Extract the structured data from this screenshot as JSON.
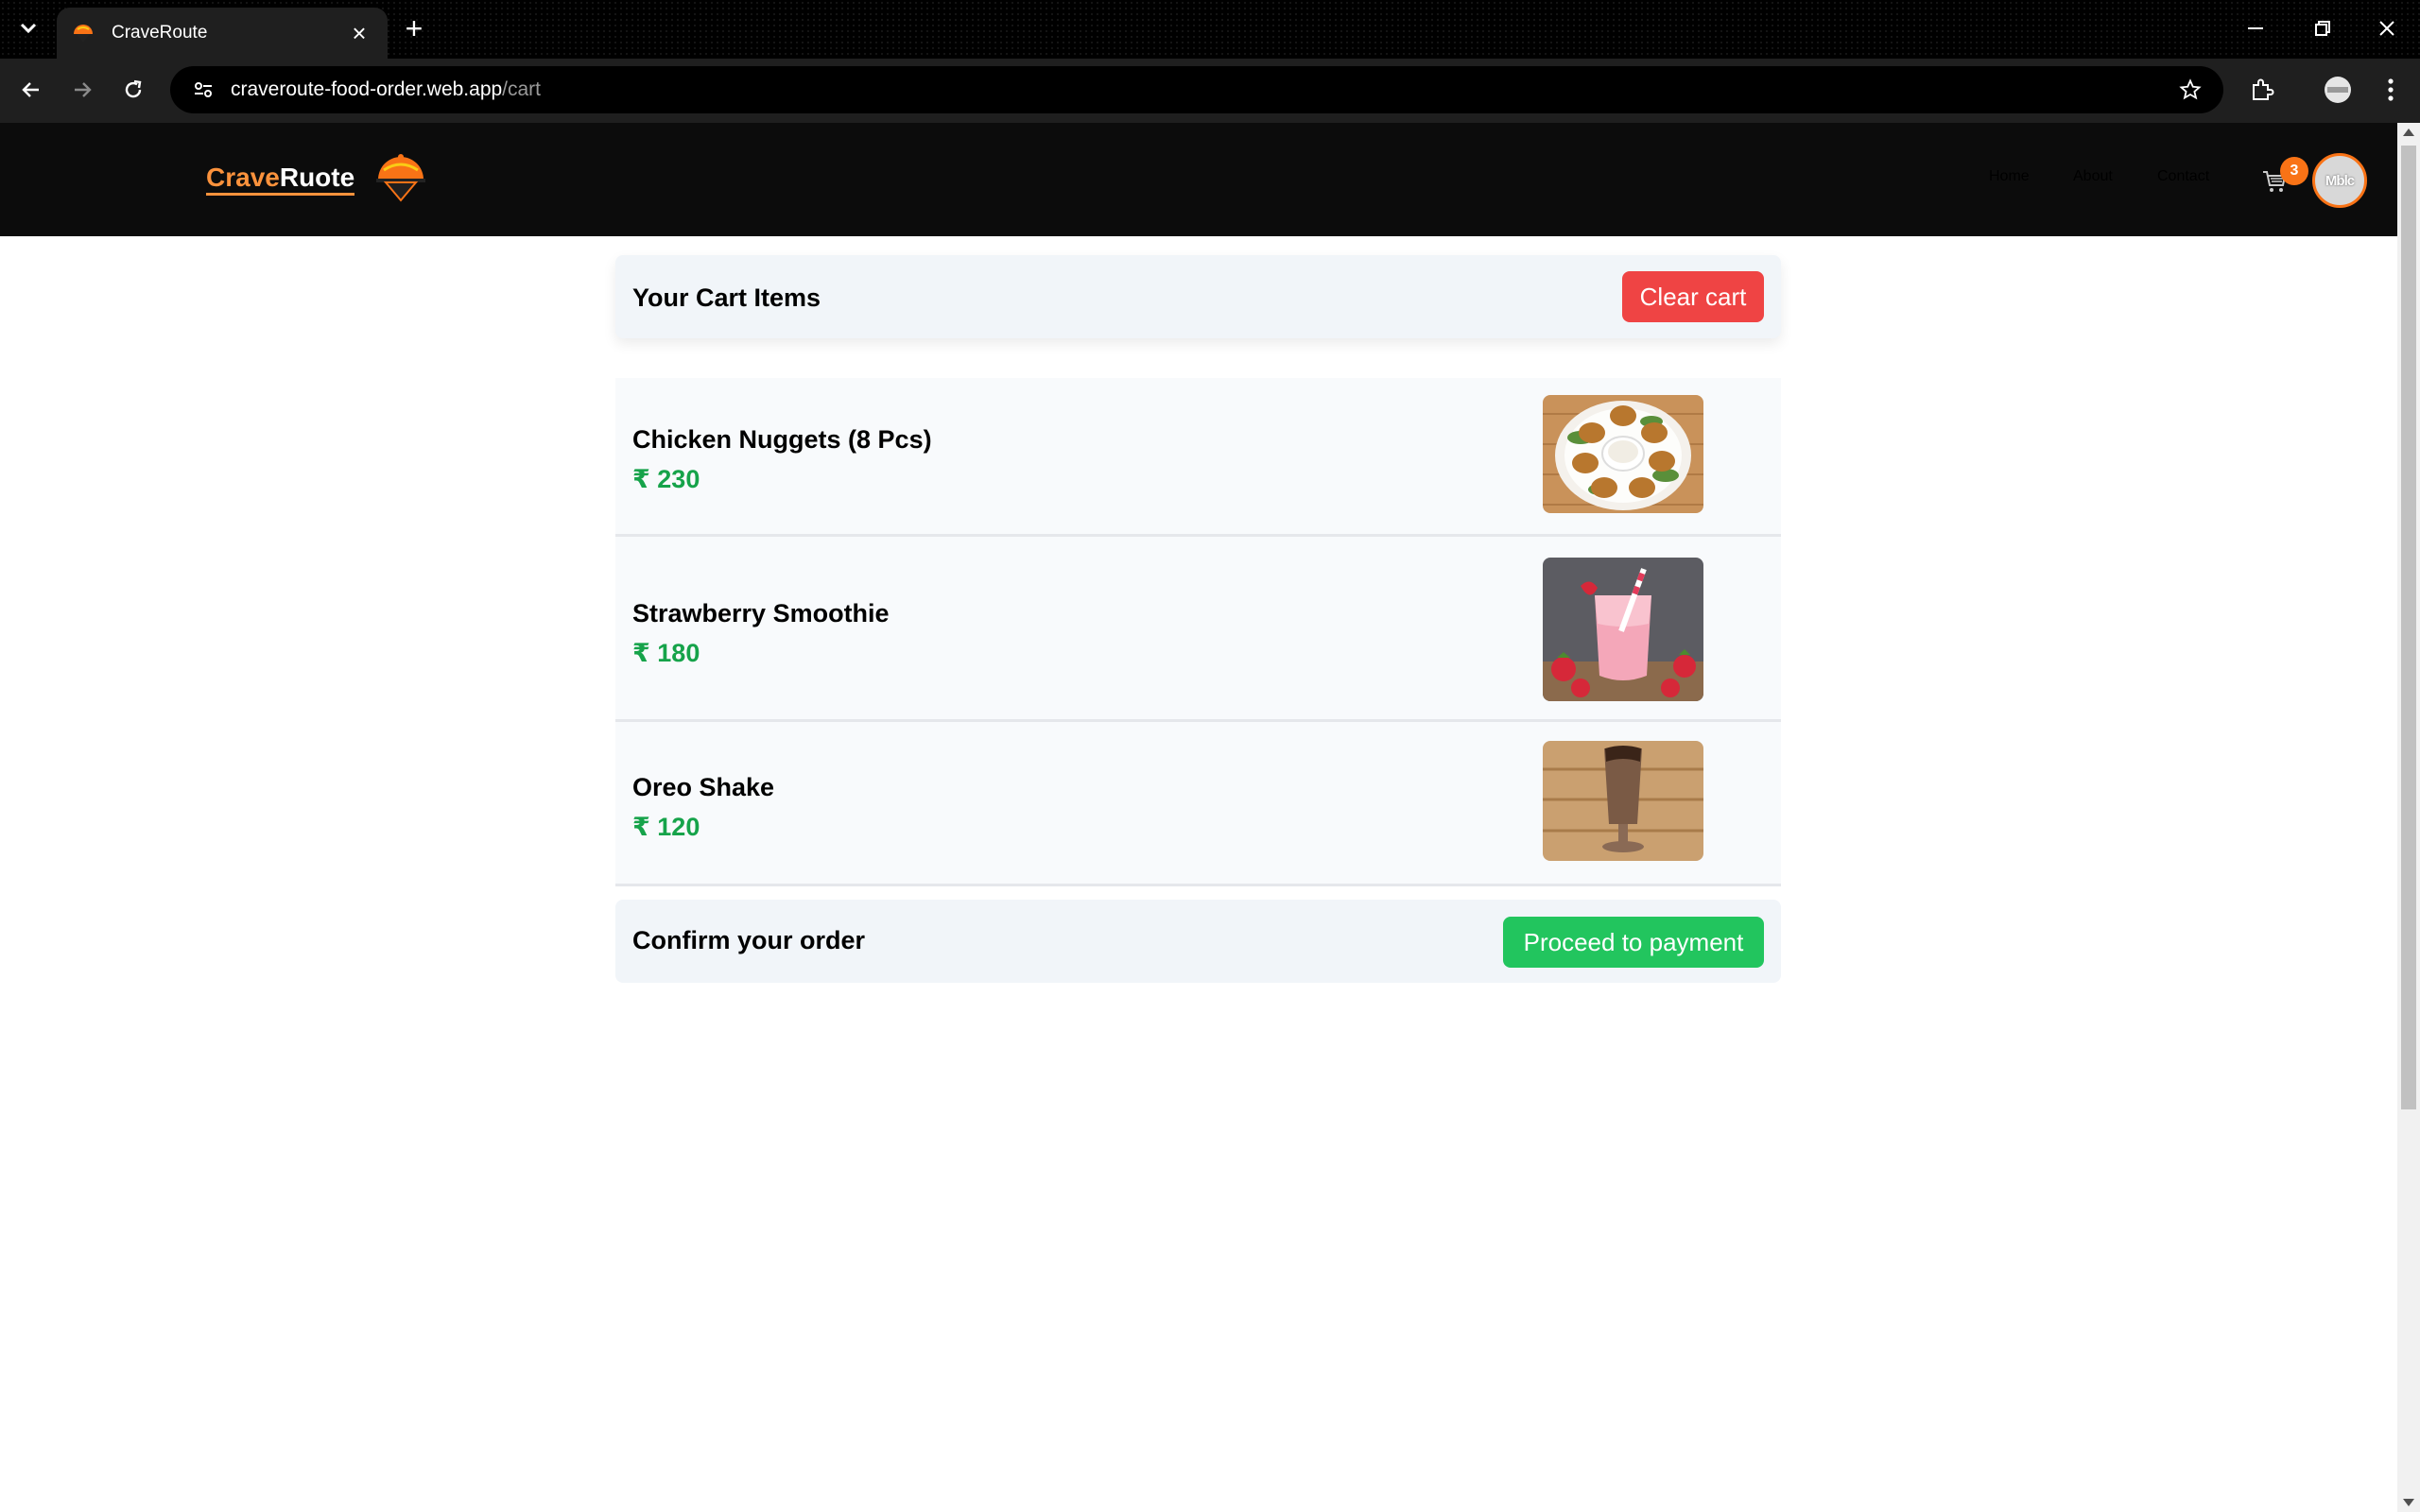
{
  "browser": {
    "tab_title": "CraveRoute",
    "url_host": "craveroute-food-order.web.app",
    "url_path": "/cart"
  },
  "site": {
    "brand_part1": "Crave",
    "brand_part2": "Ruote",
    "nav": [
      "Home",
      "About",
      "Contact"
    ],
    "cart_count": "3",
    "avatar_text": "Mblc"
  },
  "cart": {
    "heading": "Your Cart Items",
    "clear_label": "Clear cart",
    "items": [
      {
        "name": "Chicken Nuggets (8 Pcs)",
        "price": "₹ 230",
        "image": "chicken-nuggets-photo"
      },
      {
        "name": "Strawberry Smoothie",
        "price": "₹ 180",
        "image": "strawberry-smoothie-photo"
      },
      {
        "name": "Oreo Shake",
        "price": "₹ 120",
        "image": "oreo-shake-photo"
      }
    ],
    "confirm_label": "Confirm your order",
    "pay_label": "Proceed to payment"
  },
  "colors": {
    "brand_orange": "#fb923c",
    "price_green": "#16a34a",
    "clear_red": "#ef4444",
    "pay_green": "#22c55e",
    "header_bg": "#0c0c0c"
  }
}
